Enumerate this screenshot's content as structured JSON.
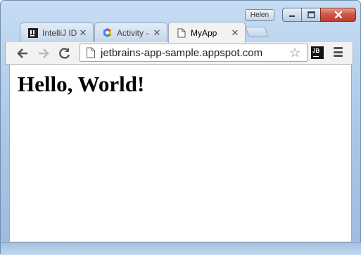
{
  "window": {
    "profile_name": "Helen",
    "controls": {
      "minimize_icon": "minimize-icon",
      "maximize_icon": "maximize-icon",
      "close_icon": "close-icon"
    }
  },
  "tabs": [
    {
      "title": "IntelliJ ID",
      "icon": "intellij-icon",
      "active": false
    },
    {
      "title": "Activity -",
      "icon": "google-cloud-icon",
      "active": false
    },
    {
      "title": "MyApp",
      "icon": "page-icon",
      "active": true
    }
  ],
  "tab_close_glyph": "✕",
  "toolbar": {
    "url": "jetbrains-app-sample.appspot.com",
    "jb_extension_label": "JB"
  },
  "page": {
    "heading": "Hello, World!"
  },
  "colors": {
    "window_frame": "#a9c6e6",
    "close_button": "#c13b2b",
    "tab_active": "#f2f2f2"
  }
}
